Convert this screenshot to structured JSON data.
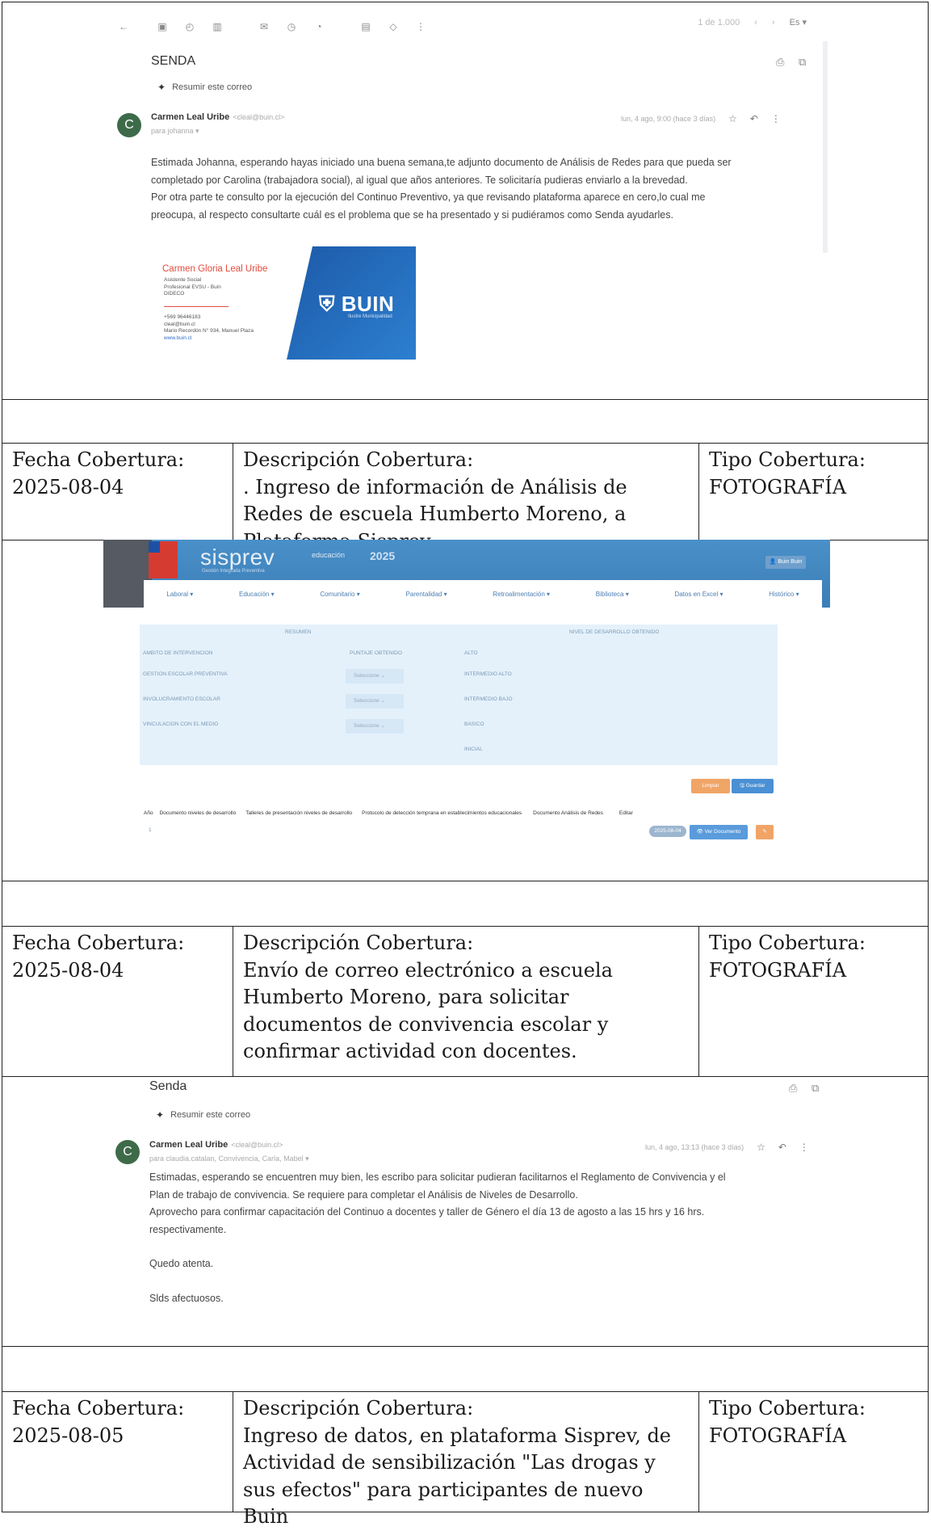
{
  "email1": {
    "toolbar": {
      "icons": [
        "back-arrow-icon",
        "archive-icon",
        "report-icon",
        "trash-icon",
        "mail-icon",
        "clock-icon",
        "task-icon",
        "move-icon",
        "label-icon",
        "more-icon"
      ],
      "counter": "1 de 1.000",
      "lang": "Es"
    },
    "subject": "SENDA",
    "summarize_label": "Resumir este correo",
    "sender_name": "Carmen Leal Uribe",
    "sender_email": "<cleal@buin.cl>",
    "to_line": "para johanna",
    "date": "lun, 4 ago, 9:00 (hace 3 días)",
    "avatar_letter": "C",
    "body": [
      "Estimada Johanna, esperando hayas iniciado una buena semana,te adjunto documento de Análisis de  Redes para que pueda ser",
      "completado por Carolina (trabajadora social), al igual que años anteriores. Te solicitaría pudieras enviarlo a la brevedad.",
      "Por otra parte te consulto por la ejecución del Continuo Preventivo, ya que revisando plataforma aparece en cero,lo cual me",
      "preocupa, al respecto consultarte cuál es el problema que se ha presentado y si pudiéramos como Senda ayudarles."
    ],
    "signature": {
      "name": "Carmen Gloria Leal Uribe",
      "lines_top": [
        "Asistente Social",
        "Profesional EVSU - Buin",
        "DIDECO"
      ],
      "lines_bottom": [
        "+569 96446183",
        "cleal@buin.cl",
        "Mario Recordón N° 934, Manuel Plaza",
        "www.buin.cl"
      ],
      "logo_text": "BUIN",
      "logo_sub": "Ilustre Municipalidad"
    }
  },
  "row1": {
    "fecha_label": "Fecha Cobertura:",
    "fecha": "2025-08-04",
    "desc_label": "Descripción Cobertura:",
    "desc": ". Ingreso de información de Análisis de Redes de escuela Humberto Moreno, a Plataforma Sisprev.",
    "tipo_label": "Tipo Cobertura:",
    "tipo": "FOTOGRAFÍA"
  },
  "sisprev": {
    "logo": "sisprev",
    "logo_sub": "Gestión Integrada Preventiva",
    "edu": "educación",
    "year": "2025",
    "user": "Buin Buin",
    "nav": [
      "Laboral",
      "Educación",
      "Comunitario",
      "Parentalidad",
      "Retroalimentación",
      "Biblioteca",
      "Datos en Excel",
      "Histórico"
    ],
    "resumen": "RESUMEN",
    "nivel_header": "NIVEL DE DESARROLLO OBTENIDO",
    "ambito_header": "AMBITO DE INTERVENCION",
    "puntaje_header": "PUNTAJE OBTENIDO",
    "ambitos": [
      "GESTION ESCOLAR PREVENTIVA",
      "INVOLUCRAMIENTO ESCOLAR",
      "VINCULACION CON EL MEDIO"
    ],
    "select_placeholder": "Seleccione",
    "niveles": [
      "ALTO",
      "INTERMEDIO ALTO",
      "INTERMEDIO BAJO",
      "BASICO",
      "INICIAL"
    ],
    "btn_limpiar": "Limpiar",
    "btn_guardar": "Guardar",
    "doc_cols": [
      "Año",
      "Documento niveles de desarrollo",
      "Talleres de presentación niveles de desarrollo",
      "Protocolo de detección temprana en establecimientos educacionales",
      "Documento Análisis de Redes",
      "Editar"
    ],
    "doc_year": "1",
    "doc_date": "2025-08-04",
    "btn_ver": "Ver Documento"
  },
  "row2": {
    "fecha_label": "Fecha Cobertura:",
    "fecha": "2025-08-04",
    "desc_label": "Descripción Cobertura:",
    "desc": "Envío de correo electrónico a escuela Humberto Moreno, para solicitar documentos de convivencia escolar y confirmar actividad con docentes.",
    "tipo_label": "Tipo Cobertura:",
    "tipo": "FOTOGRAFÍA"
  },
  "email2": {
    "subject": "Senda",
    "summarize_label": "Resumir este correo",
    "sender_name": "Carmen Leal Uribe",
    "sender_email": "<cleal@buin.cl>",
    "to_line": "para claudia.catalan, Convivencia, Carla, Mabel",
    "date": "lun, 4 ago, 13:13 (hace 3 días)",
    "avatar_letter": "C",
    "body": [
      "Estimadas, esperando se encuentren muy bien, les escribo para solicitar pudieran facilitarnos el Reglamento de Convivencia y el",
      "Plan de trabajo de convivencia. Se requiere para completar el Análisis de Niveles de Desarrollo.",
      "Aprovecho para confirmar capacitación del Continuo a docentes y taller de Género el día 13 de agosto a las 15 hrs y 16 hrs.",
      "respectivamente."
    ],
    "closing": "Quedo atenta.",
    "regards": "Slds afectuosos."
  },
  "row3": {
    "fecha_label": "Fecha Cobertura:",
    "fecha": "2025-08-05",
    "desc_label": "Descripción Cobertura:",
    "desc": "Ingreso de datos, en plataforma Sisprev, de Actividad de sensibilización \"Las drogas y sus efectos\" para participantes de nuevo Buin",
    "tipo_label": "Tipo Cobertura:",
    "tipo": "FOTOGRAFÍA"
  }
}
